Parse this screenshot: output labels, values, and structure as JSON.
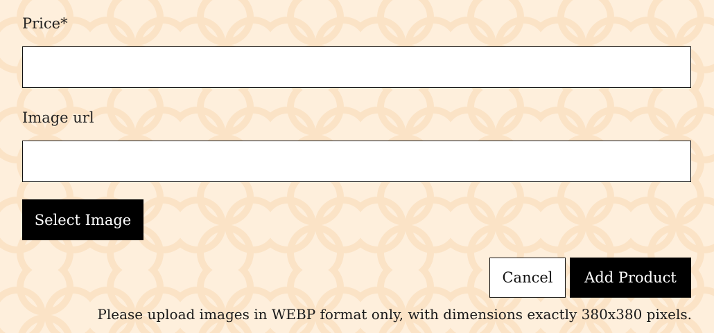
{
  "form": {
    "price_label": "Price*",
    "price_value": "",
    "image_url_label": "Image url",
    "image_url_value": "",
    "select_image_label": "Select Image",
    "cancel_label": "Cancel",
    "add_product_label": "Add Product",
    "upload_note": "Please upload images in WEBP format only, with dimensions exactly 380x380 pixels."
  },
  "colors": {
    "background": "#feefdc",
    "pattern_stroke": "#fbe3c6",
    "button_dark": "#000000",
    "button_light": "#ffffff"
  }
}
